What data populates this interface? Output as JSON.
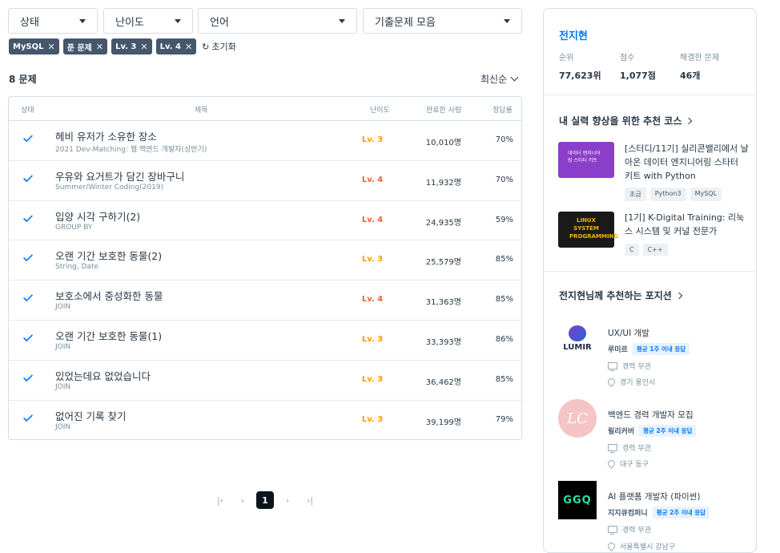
{
  "filters": [
    {
      "label": "상태"
    },
    {
      "label": "난이도"
    },
    {
      "label": "언어"
    },
    {
      "label": "기출문제 모음"
    }
  ],
  "chips": [
    "MySQL",
    "푼 문제",
    "Lv. 3",
    "Lv. 4"
  ],
  "reset_label": "초기화",
  "count_label": "8 문제",
  "sort_label": "최신순",
  "columns": {
    "status": "상태",
    "title": "제목",
    "level": "난이도",
    "done": "완료한 사람",
    "rate": "정답률"
  },
  "problems": [
    {
      "title": "헤비 유저가 소유한 장소",
      "sub": "2021 Dev-Matching: 웹 백엔드 개발자(상반기)",
      "level": "Lv. 3",
      "done": "10,010명",
      "rate": "70%"
    },
    {
      "title": "우유와 요거트가 담긴 장바구니",
      "sub": "Summer/Winter Coding(2019)",
      "level": "Lv. 4",
      "done": "11,932명",
      "rate": "70%"
    },
    {
      "title": "입양 시각 구하기(2)",
      "sub": "GROUP BY",
      "level": "Lv. 4",
      "done": "24,935명",
      "rate": "59%"
    },
    {
      "title": "오랜 기간 보호한 동물(2)",
      "sub": "String, Date",
      "level": "Lv. 3",
      "done": "25,579명",
      "rate": "85%"
    },
    {
      "title": "보호소에서 중성화한 동물",
      "sub": "JOIN",
      "level": "Lv. 4",
      "done": "31,363명",
      "rate": "85%"
    },
    {
      "title": "오랜 기간 보호한 동물(1)",
      "sub": "JOIN",
      "level": "Lv. 3",
      "done": "33,393명",
      "rate": "86%"
    },
    {
      "title": "있었는데요 없었습니다",
      "sub": "JOIN",
      "level": "Lv. 3",
      "done": "36,462명",
      "rate": "85%"
    },
    {
      "title": "없어진 기록 찾기",
      "sub": "JOIN",
      "level": "Lv. 3",
      "done": "39,199명",
      "rate": "79%"
    }
  ],
  "level_colors": {
    "Lv. 3": "#ff9c00",
    "Lv. 4": "#f15e3b"
  },
  "pager": {
    "current": "1"
  },
  "profile": {
    "name": "전지현",
    "rank_label": "순위",
    "rank": "77,623위",
    "score_label": "점수",
    "score": "1,077점",
    "solved_label": "해결한 문제",
    "solved": "46개"
  },
  "courses_title": "내 실력 향상을 위한 추천 코스",
  "courses": [
    {
      "title": "[스터디/11기] 실리콘밸리에서 날아온 데이터 엔지니어링 스타터 키트 with Python",
      "tags": [
        "초급",
        "Python3",
        "MySQL"
      ],
      "thumb_text": "데이터 엔지니어링 스타터 키트"
    },
    {
      "title": "[1기] K-Digital Training: 리눅스 시스템 및 커널 전문가",
      "tags": [
        "C",
        "C++"
      ],
      "thumb_text": "LINUX SYSTEM PROGRAMMING"
    }
  ],
  "jobs_title": "전지현님께 추천하는 포지션",
  "jobs": [
    {
      "title": "UX/UI 개발",
      "company": "루미르",
      "badge": "평균 1주 이내 응답",
      "career": "경력 무관",
      "location": "경기 용인시",
      "logo_text": "LUMIR"
    },
    {
      "title": "백엔드 경력 개발자 모집",
      "company": "릴리커버",
      "badge": "평균 2주 이내 응답",
      "career": "경력 무관",
      "location": "대구 동구",
      "logo_text": "LC"
    },
    {
      "title": "AI 플랫폼 개발자 (파이썬)",
      "company": "지지큐컴퍼니",
      "badge": "평균 2주 이내 응답",
      "career": "경력 무관",
      "location": "서울특별시 강남구",
      "logo_text": "GGQ"
    }
  ]
}
